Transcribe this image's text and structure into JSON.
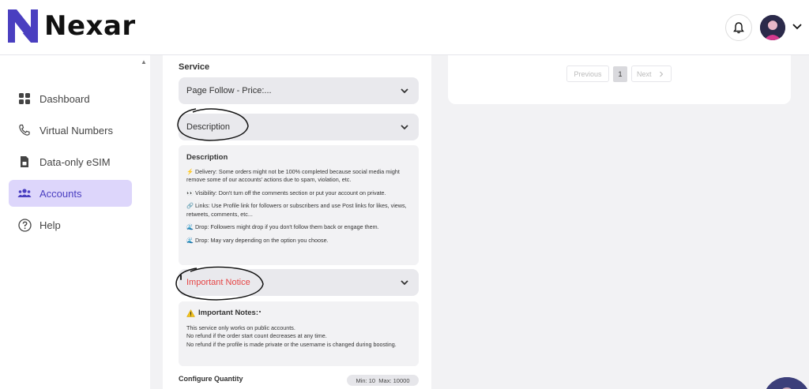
{
  "brand": {
    "name": "Nexar",
    "accent": "#4a3fc0"
  },
  "header": {
    "bell_icon": "bell-icon",
    "avatar_icon": "user-avatar",
    "menu_icon": "chevron-down-icon"
  },
  "sidebar": {
    "items": [
      {
        "label": "Dashboard",
        "icon": "grid-icon",
        "active": false
      },
      {
        "label": "Virtual Numbers",
        "icon": "phone-icon",
        "active": false
      },
      {
        "label": "Data-only eSIM",
        "icon": "sim-icon",
        "active": false
      },
      {
        "label": "Accounts",
        "icon": "users-icon",
        "active": true
      },
      {
        "label": "Help",
        "icon": "help-icon",
        "active": false
      }
    ]
  },
  "form": {
    "service_label": "Service",
    "service_value": "Page Follow - Price:...",
    "description_toggle": "Description",
    "description": {
      "title": "Description",
      "lines": [
        "⚡ Delivery: Some orders might not be 100% completed because social media might remove some of our accounts' actions due to spam, violation, etc.",
        "👀 Visibility: Don't turn off the comments section or put your account on private.",
        "🔗 Links: Use Profile link for followers or subscribers and use Post links for likes, views, retweets, comments, etc...",
        "🌊 Drop: Followers might drop if you don't follow them back or engage them.",
        "🌊 Drop: May vary depending on the option you choose."
      ]
    },
    "notice_toggle": "Important Notice",
    "notice": {
      "title": "Important Notes:",
      "lines": [
        "This service only works on public accounts.",
        "No refund if the order start count decreases at any time.",
        "No refund if the profile is made private or the username is changed during boosting."
      ]
    },
    "quantity_label": "Configure Quantity",
    "quantity_min_label": "Min:",
    "quantity_min": "10",
    "quantity_max_label": "Max:",
    "quantity_max": "10000"
  },
  "pagination": {
    "previous": "Previous",
    "page": "1",
    "next": "Next"
  },
  "colors": {
    "notice_text": "#e64545",
    "active_bg": "#ddd6fb",
    "main_bg": "#f2f2f4"
  }
}
